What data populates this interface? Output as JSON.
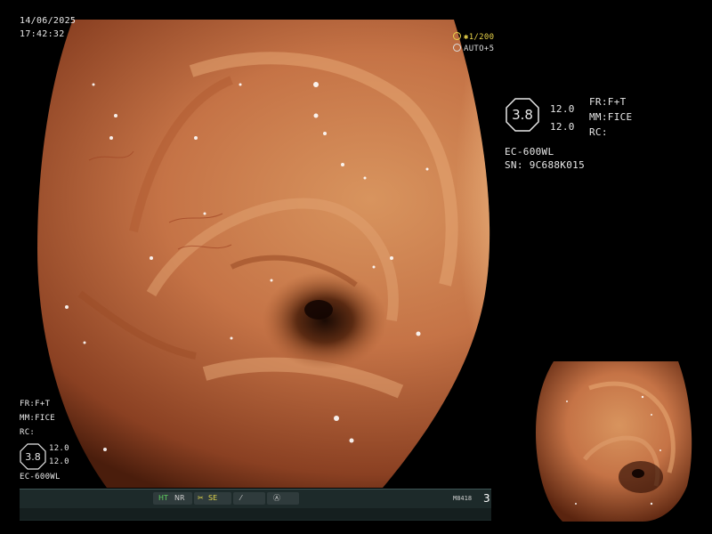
{
  "datetime": {
    "date": "14/06/2025",
    "time": "17:42:32"
  },
  "shutter": {
    "speed": "1/200",
    "auto": "AUTO+5"
  },
  "right_panel": {
    "zoom": "3.8",
    "values": [
      "12.0",
      "12.0"
    ],
    "settings": [
      "FR:F+T",
      "MM:FICE",
      "RC:"
    ],
    "scope_model": "EC-600WL",
    "serial": "SN: 9C688K015"
  },
  "left_panel": {
    "settings": [
      "FR:F+T",
      "MM:FICE",
      "RC:"
    ],
    "zoom": "3.8",
    "values": [
      "12.0",
      "12.0"
    ],
    "scope_model": "EC-600WL"
  },
  "status_bar": {
    "ht": "HT",
    "nr": "NR",
    "se": "SE",
    "code": "M8418",
    "number": "3"
  },
  "colors": {
    "mucosa": "#c8764a",
    "status_green": "#5fd35f",
    "status_yellow": "#e3d64a",
    "shutter_yellow": "#e9d34a"
  },
  "icons": [
    "shutter-icon",
    "auto-icon",
    "scissors-icon",
    "slash-icon",
    "a-circle-icon"
  ]
}
